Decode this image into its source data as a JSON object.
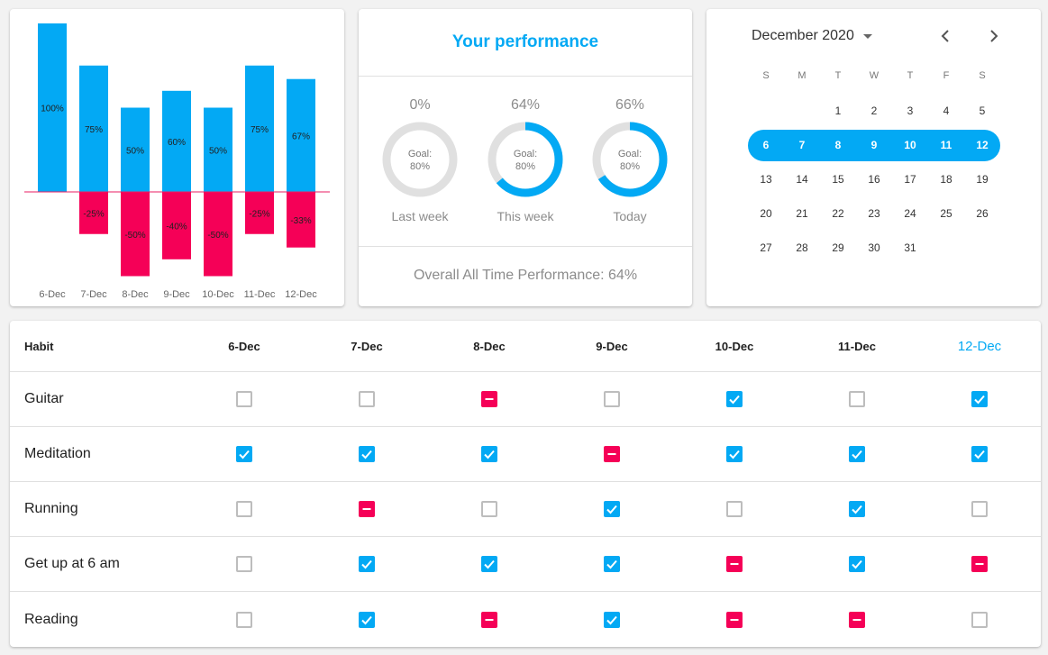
{
  "colors": {
    "positive": "#03a9f4",
    "negative": "#f50057",
    "baseline": "#e91e63",
    "ring_track": "#e0e0e0"
  },
  "chart_data": {
    "type": "bar",
    "categories": [
      "6-Dec",
      "7-Dec",
      "8-Dec",
      "9-Dec",
      "10-Dec",
      "11-Dec",
      "12-Dec"
    ],
    "series": [
      {
        "values": [
          100,
          75,
          50,
          60,
          50,
          75,
          67
        ],
        "labels": [
          "100%",
          "75%",
          "50%",
          "60%",
          "50%",
          "75%",
          "67%"
        ]
      },
      {
        "values": [
          0,
          -25,
          -50,
          -40,
          -50,
          -25,
          -33
        ],
        "labels": [
          "",
          "-25%",
          "-50%",
          "-40%",
          "-50%",
          "-25%",
          "-33%"
        ]
      }
    ],
    "ylim": [
      -50,
      100
    ]
  },
  "performance": {
    "title": "Your performance",
    "rings": [
      {
        "value": 0,
        "pct_label": "0%",
        "goal_line1": "Goal:",
        "goal_line2": "80%",
        "caption": "Last week"
      },
      {
        "value": 64,
        "pct_label": "64%",
        "goal_line1": "Goal:",
        "goal_line2": "80%",
        "caption": "This week"
      },
      {
        "value": 66,
        "pct_label": "66%",
        "goal_line1": "Goal:",
        "goal_line2": "80%",
        "caption": "Today"
      }
    ],
    "overall": "Overall All Time Performance: 64%"
  },
  "calendar": {
    "month_label": "December 2020",
    "weekdays": [
      "S",
      "M",
      "T",
      "W",
      "T",
      "F",
      "S"
    ],
    "days": [
      [
        "",
        "",
        "1",
        "2",
        "3",
        "4",
        "5"
      ],
      [
        "6",
        "7",
        "8",
        "9",
        "10",
        "11",
        "12"
      ],
      [
        "13",
        "14",
        "15",
        "16",
        "17",
        "18",
        "19"
      ],
      [
        "20",
        "21",
        "22",
        "23",
        "24",
        "25",
        "26"
      ],
      [
        "27",
        "28",
        "29",
        "30",
        "31",
        "",
        ""
      ]
    ],
    "selected_week_index": 1
  },
  "habits": {
    "header": "Habit",
    "dates": [
      "6-Dec",
      "7-Dec",
      "8-Dec",
      "9-Dec",
      "10-Dec",
      "11-Dec",
      "12-Dec"
    ],
    "today_index": 6,
    "rows": [
      {
        "name": "Guitar",
        "states": [
          "empty",
          "empty",
          "minus",
          "empty",
          "check",
          "empty",
          "check"
        ]
      },
      {
        "name": "Meditation",
        "states": [
          "check",
          "check",
          "check",
          "minus",
          "check",
          "check",
          "check"
        ]
      },
      {
        "name": "Running",
        "states": [
          "empty",
          "minus",
          "empty",
          "check",
          "empty",
          "check",
          "empty"
        ]
      },
      {
        "name": "Get up at 6 am",
        "states": [
          "empty",
          "check",
          "check",
          "check",
          "minus",
          "check",
          "minus"
        ]
      },
      {
        "name": "Reading",
        "states": [
          "empty",
          "check",
          "minus",
          "check",
          "minus",
          "minus",
          "empty"
        ]
      }
    ]
  }
}
